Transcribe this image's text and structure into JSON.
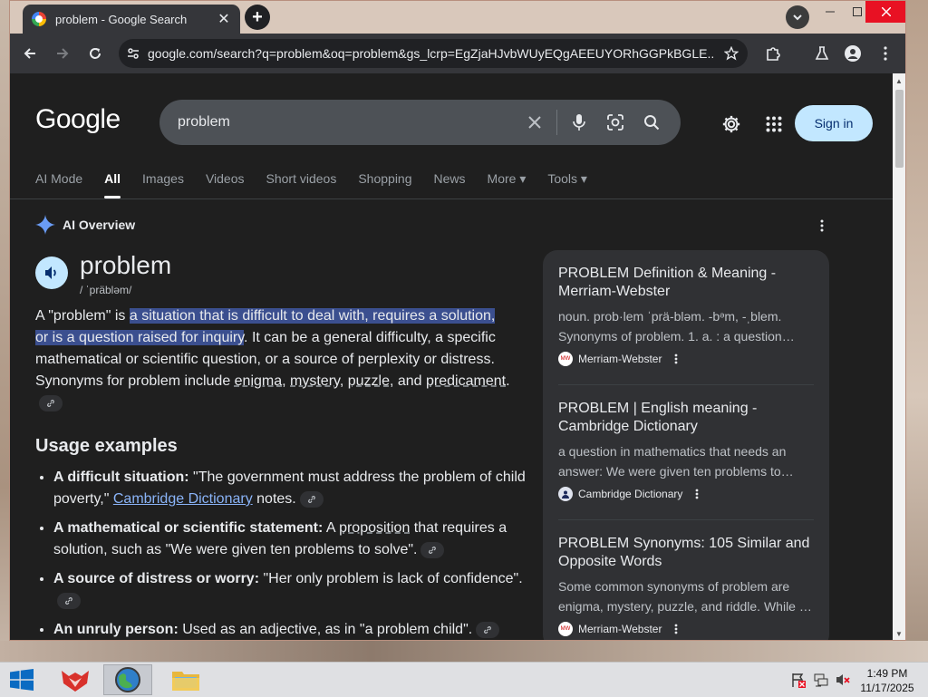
{
  "browser": {
    "tab_title": "problem - Google Search",
    "url": "google.com/search?q=problem&oq=problem&gs_lcrp=EgZjaHJvbWUyEQgAEEUYORhGGPkBGLE...",
    "new_tab_symbol": "+",
    "close_symbol": "✕"
  },
  "header": {
    "logo": "Google",
    "search_query": "problem",
    "signin_label": "Sign in"
  },
  "nav_tabs": [
    "AI Mode",
    "All",
    "Images",
    "Videos",
    "Short videos",
    "Shopping",
    "News",
    "More ▾",
    "Tools ▾"
  ],
  "active_tab": "All",
  "ai_overview": {
    "title": "AI Overview",
    "word": "problem",
    "phonetic": "/ ˈpräbləm/",
    "definition": {
      "prefix": "A \"problem\" is ",
      "highlight": "a situation that is difficult to deal with, requires a solution, or is a question raised for inquiry",
      "mid": ". It can be a general difficulty, a specific mathematical or scientific question, or a source of perplexity or distress. Synonyms for problem include ",
      "syn1": "enigma",
      "sep1": ", ",
      "syn2": "mystery",
      "sep2": ", ",
      "syn3": "puzzle",
      "sep3": ", and ",
      "syn4": "predicament",
      "end": "."
    },
    "usage_title": "Usage examples",
    "usage": [
      {
        "label": "A difficult situation:",
        "text": " \"The government must address the problem of child poverty,\" ",
        "link": "Cambridge Dictionary",
        "tail": " notes."
      },
      {
        "label": "A mathematical or scientific statement:",
        "text": " A ",
        "term": "proposition",
        "text2": " that requires a solution, such as \"We were given ten problems to solve\"."
      },
      {
        "label": "A source of distress or worry:",
        "text": " \"Her only problem is lack of confidence\"."
      },
      {
        "label": "An unruly person:",
        "text": " Used as an adjective, as in \"a problem child\"."
      }
    ]
  },
  "sources": [
    {
      "title": "PROBLEM Definition & Meaning - Merriam-Webster",
      "snippet": "noun. prob·lem ˈprä-bləm. -bᵊm, -ˌblem. Synonyms of problem. 1. a. : a question…",
      "site": "Merriam-Webster",
      "favicon": "MW"
    },
    {
      "title": "PROBLEM | English meaning - Cambridge Dictionary",
      "snippet": "a question in mathematics that needs an answer: We were given ten problems to…",
      "site": "Cambridge Dictionary",
      "favicon": ""
    },
    {
      "title": "PROBLEM Synonyms: 105 Similar and Opposite Words",
      "snippet": "Some common synonyms of problem are enigma, mystery, puzzle, and riddle. While …",
      "site": "Merriam-Webster",
      "favicon": "MW"
    }
  ],
  "taskbar": {
    "time": "1:49 PM",
    "date": "11/17/2025"
  },
  "colors": {
    "page_bg": "#1f1f1f",
    "highlight": "#3b4f8f",
    "link": "#8ab4f8",
    "signin_bg": "#c2e7ff"
  }
}
